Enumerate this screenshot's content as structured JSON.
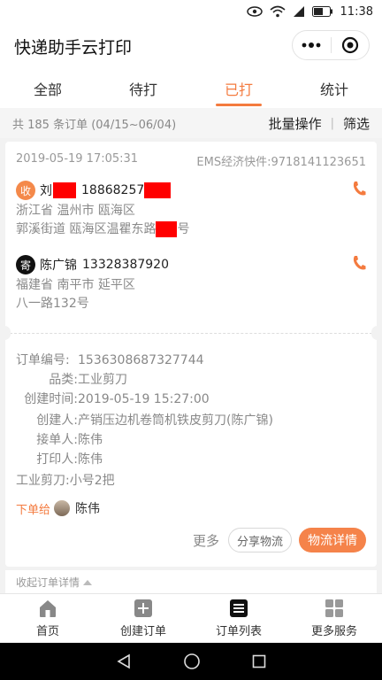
{
  "status_bar": {
    "time": "11:38"
  },
  "app": {
    "title": "快递助手云打印"
  },
  "tabs": [
    {
      "label": "全部",
      "active": false
    },
    {
      "label": "待打",
      "active": false
    },
    {
      "label": "已打",
      "active": true
    },
    {
      "label": "统计",
      "active": false
    }
  ],
  "summary": {
    "text": "共 185 条订单 (04/15~06/04)",
    "bulk_label": "批量操作",
    "divider": "|",
    "filter_label": "筛选"
  },
  "order": {
    "datetime": "2019-05-19 17:05:31",
    "tracking": "EMS经济快件:9718141123651",
    "recipient": {
      "badge": "收",
      "name": "刘",
      "phone": "18868257",
      "addr_line1": "浙江省 温州市 瓯海区",
      "addr_line2a": "郭溪街道 瓯海区温瞿东路",
      "addr_line2b": "号"
    },
    "sender": {
      "badge": "寄",
      "name": "陈广锦",
      "phone": "13328387920",
      "addr_line1": "福建省 南平市 延平区",
      "addr_line2": "八一路132号"
    },
    "details": [
      {
        "label": "订单编号:",
        "value": "1536308687327744"
      },
      {
        "label": "品类:",
        "value": "工业剪刀"
      },
      {
        "label": "创建时间:",
        "value": "2019-05-19 15:27:00"
      },
      {
        "label": "创建人:",
        "value": "产销压边机卷筒机铁皮剪刀(陈广锦)"
      },
      {
        "label": "接单人:",
        "value": "陈伟"
      },
      {
        "label": "打印人:",
        "value": "陈伟"
      }
    ],
    "items_note": "工业剪刀:小号2把",
    "assign_label": "下单给",
    "assign_to": "陈伟",
    "actions": {
      "more": "更多",
      "share": "分享物流",
      "logistics": "物流详情"
    },
    "collapse_label": "收起订单详情"
  },
  "bottom_nav": [
    {
      "label": "首页",
      "icon": "home-icon"
    },
    {
      "label": "创建订单",
      "icon": "plus-square-icon"
    },
    {
      "label": "订单列表",
      "icon": "list-icon"
    },
    {
      "label": "更多服务",
      "icon": "grid-icon"
    }
  ],
  "colors": {
    "accent": "#f47b3f",
    "primary_button": "#f5834a",
    "redaction": "#ff0000"
  }
}
